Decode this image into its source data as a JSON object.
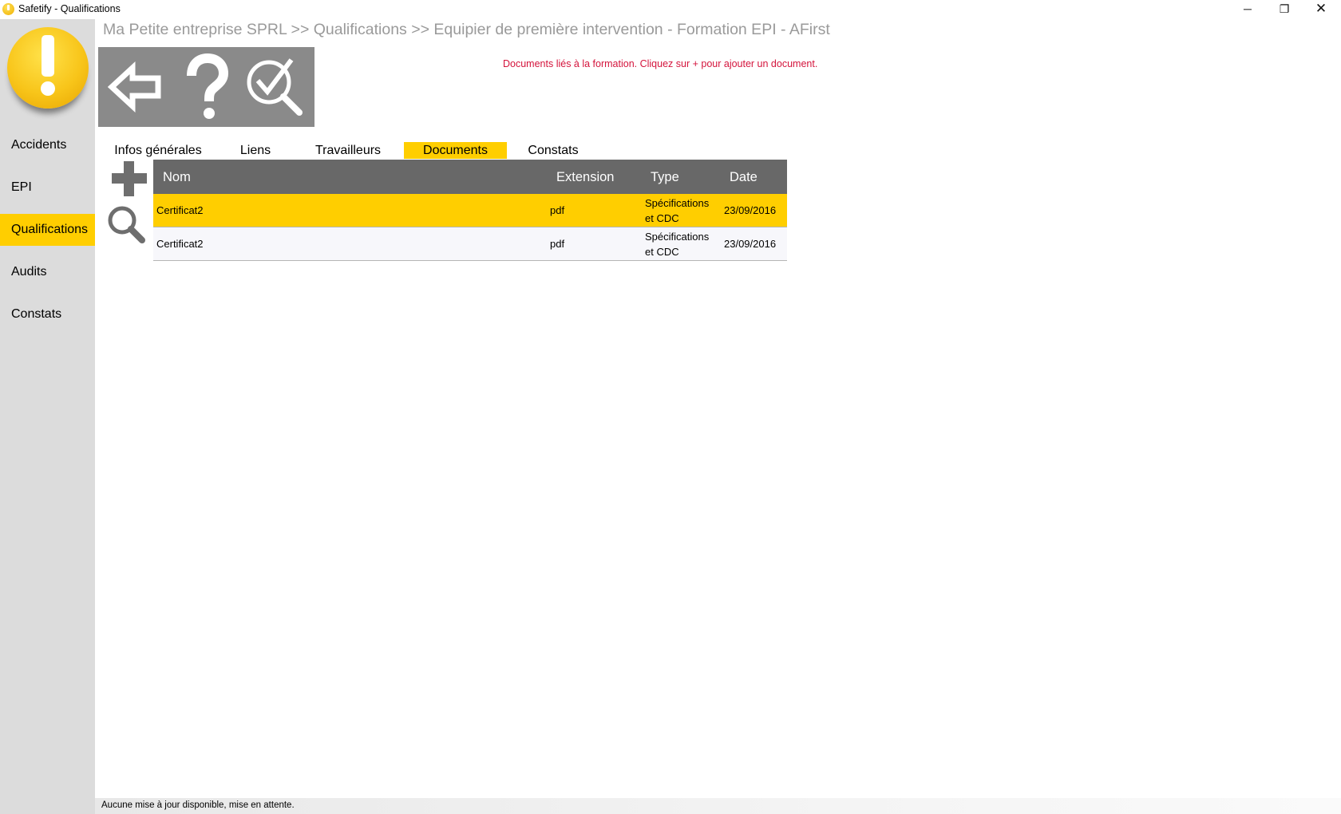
{
  "window": {
    "title": "Safetify - Qualifications",
    "minimize_glyph": "─",
    "maximize_glyph": "❐",
    "close_glyph": "✕"
  },
  "sidebar": {
    "logo_icon": "exclamation-logo-icon",
    "items": [
      {
        "label": "Accidents",
        "active": false
      },
      {
        "label": "EPI",
        "active": false
      },
      {
        "label": "Qualifications",
        "active": true
      },
      {
        "label": "Audits",
        "active": false
      },
      {
        "label": "Constats",
        "active": false
      }
    ]
  },
  "breadcrumb": "Ma Petite entreprise SPRL >> Qualifications >> Equipier de première intervention - Formation EPI - AFirst",
  "toolbar": {
    "buttons": [
      {
        "icon": "back-arrow-icon"
      },
      {
        "icon": "help-question-icon"
      },
      {
        "icon": "search-check-icon"
      }
    ]
  },
  "hint": "Documents liés à la formation. Cliquez sur + pour ajouter un document.",
  "tabs": [
    {
      "label": "Infos générales",
      "active": false
    },
    {
      "label": "Liens",
      "active": false
    },
    {
      "label": "Travailleurs",
      "active": false
    },
    {
      "label": "Documents",
      "active": true
    },
    {
      "label": "Constats",
      "active": false
    }
  ],
  "actions": {
    "add_icon": "plus-icon",
    "search_icon": "search-icon"
  },
  "table": {
    "headers": [
      "Nom",
      "Extension",
      "Type",
      "Date"
    ],
    "rows": [
      {
        "nom": "Certificat2",
        "extension": "pdf",
        "type": "Spécifications et CDC",
        "date": "23/09/2016",
        "selected": true
      },
      {
        "nom": "Certificat2",
        "extension": "pdf",
        "type": "Spécifications et CDC",
        "date": "23/09/2016",
        "selected": false
      }
    ]
  },
  "colors": {
    "accent": "#ffce00",
    "sidebar_bg": "#dcdcdc",
    "toolbar_bg": "#8a8a8a",
    "header_bg": "#686868",
    "hint": "#d4143c"
  },
  "status": "Aucune mise à jour disponible, mise en attente."
}
